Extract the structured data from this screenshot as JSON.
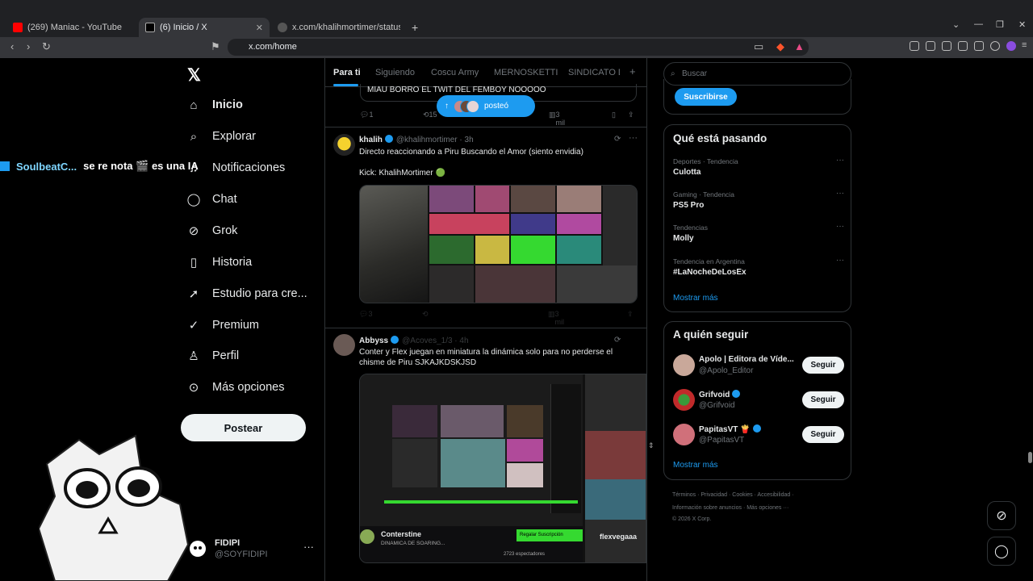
{
  "browser": {
    "tabs": [
      {
        "label": "(269) Maniac - YouTube"
      },
      {
        "label": "(6) Inicio / X"
      },
      {
        "label": "x.com/khalihmortimer/status/20909"
      }
    ],
    "new_tab": "+",
    "url": "x.com/home"
  },
  "nav": {
    "logo": "𝕏",
    "items": [
      {
        "label": "Inicio"
      },
      {
        "label": "Explorar"
      },
      {
        "label": "Notificaciones"
      },
      {
        "label": "Chat"
      },
      {
        "label": "Grok"
      },
      {
        "label": "Historia"
      },
      {
        "label": "Estudio para cre..."
      },
      {
        "label": "Premium"
      },
      {
        "label": "Perfil"
      },
      {
        "label": "Más opciones"
      }
    ],
    "post_button": "Postear",
    "profile": {
      "name": "FIDIPI",
      "handle": "@SOYFIDIPI",
      "more": "···"
    }
  },
  "overlay": {
    "user": "SoulbeatC...",
    "message": "se re nota 🎬 es una IA"
  },
  "feed": {
    "tabs": [
      "Para ti",
      "Siguiendo",
      "Coscu Army",
      "MERNOSKETTI",
      "SINDICATO D"
    ],
    "add_tab": "+",
    "quote_text": "MIAU BORRO EL TWIT DEL FEMBOY NOOOOO",
    "posted_pill": "posteó",
    "actions_top": {
      "replies": "1",
      "reposts": "15",
      "views": "3 mil"
    },
    "posts": [
      {
        "name": "khalih",
        "handle": "@khalihmortimer · 3h",
        "text": "Directo reaccionando a Piru Buscando el Amor (siento envidia)",
        "text2": "Kick: KhalihMortimer 🟢",
        "actions": {
          "replies": "3",
          "views": "3 mil"
        }
      },
      {
        "name": "Abbyss",
        "handle": "@Acoves_1/3 · 4h",
        "text": "Conter y Flex juegan en miniatura la dinámica solo para no perderse el chisme de Piru SJKAJKDSKJSD",
        "embed": {
          "streamer": "Conterstine",
          "subtitle": "DINAMICA DE SOARING...",
          "button": "Regalar Suscripción",
          "viewers": "2723 espectadores",
          "side_name": "flexvegaaa"
        }
      }
    ]
  },
  "right": {
    "search_placeholder": "Buscar",
    "subscribe": "Suscribirse",
    "trends_title": "Qué está pasando",
    "trends": [
      {
        "meta": "Deportes · Tendencia",
        "name": "Culotta"
      },
      {
        "meta": "Gaming · Tendencia",
        "name": "PS5 Pro"
      },
      {
        "meta": "Tendencias",
        "name": "Molly"
      },
      {
        "meta": "Tendencia en Argentina",
        "name": "#LaNocheDeLosEx"
      }
    ],
    "show_more": "Mostrar más",
    "follow_title": "A quién seguir",
    "follow": [
      {
        "name": "Apolo | Editora de Víde...",
        "handle": "@Apolo_Editor",
        "button": "Seguir"
      },
      {
        "name": "Grifvoid",
        "handle": "@Grifvoid",
        "button": "Seguir"
      },
      {
        "name": "PapitasVT 🍟",
        "handle": "@PapitasVT",
        "button": "Seguir"
      }
    ],
    "footer_line1": "Términos · Privacidad · Cookies · Accesibilidad ·",
    "footer_line2": "Información sobre anuncios · Más opciones ···",
    "footer_line3": "© 2026 X Corp."
  },
  "colors": {
    "accent": "#1d9bf0",
    "bg": "#000000",
    "border": "#2f3336",
    "muted": "#71767b"
  }
}
